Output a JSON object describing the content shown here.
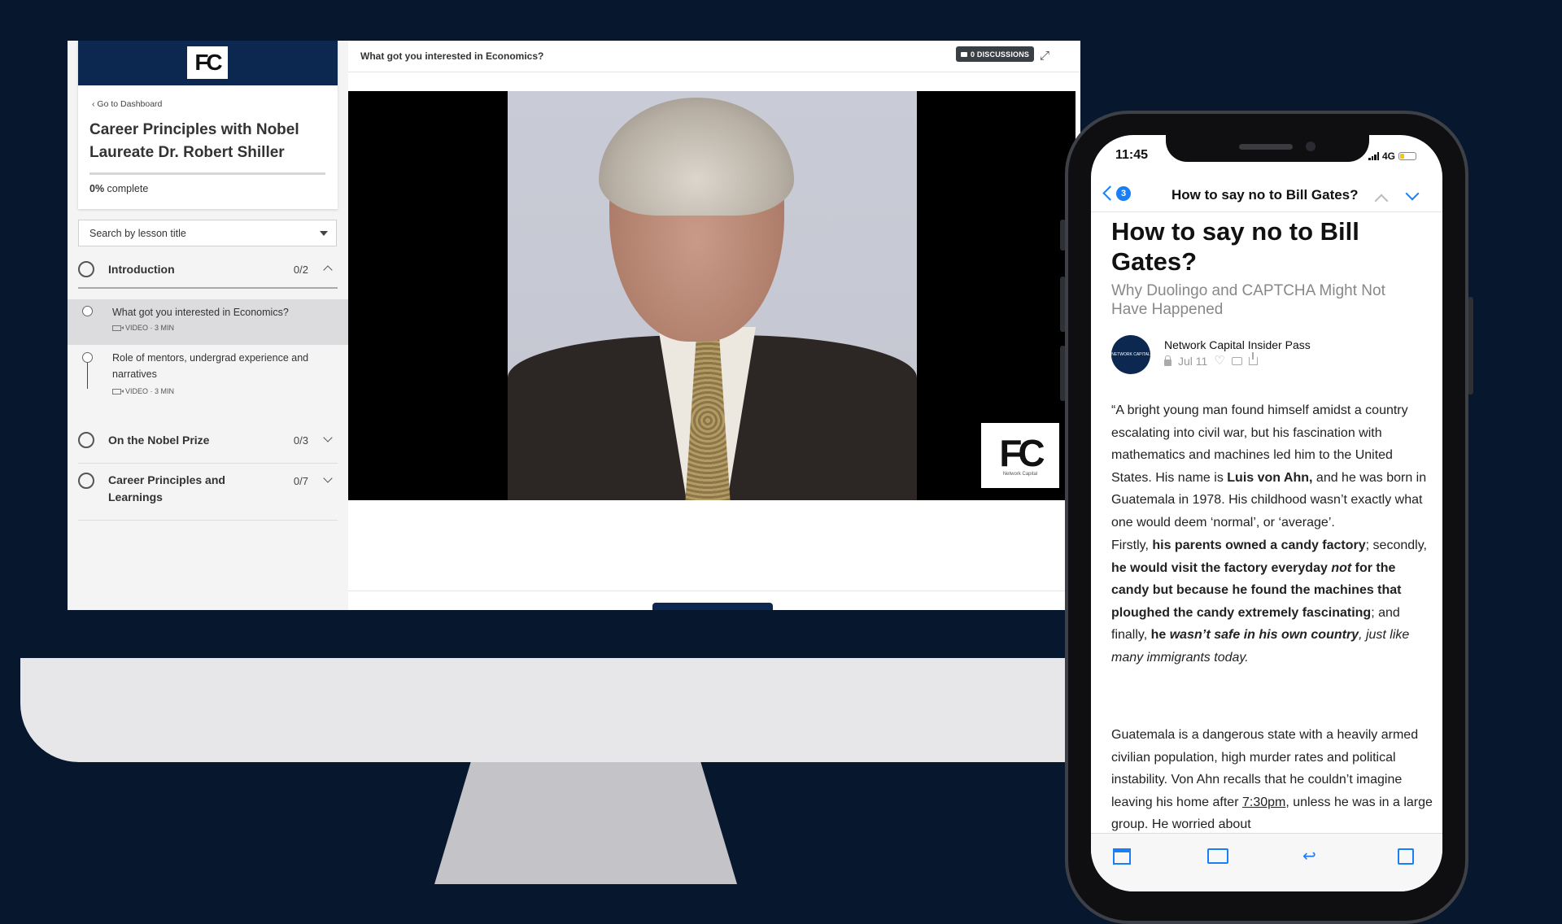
{
  "colors": {
    "background": "#06172e",
    "brand_navy": "#0d2850",
    "ios_blue": "#1a7ff5"
  },
  "course": {
    "logo_text": "FC",
    "go_to_dashboard": "Go to Dashboard",
    "title": "Career Principles with Nobel Laureate Dr. Robert Shiller",
    "progress_percent": 0,
    "progress_value": "0%",
    "progress_suffix": " complete",
    "search_placeholder": "Search by lesson title",
    "sections": [
      {
        "name": "Introduction",
        "count": "0/2",
        "expanded": true,
        "lessons": [
          {
            "title": "What got you interested in Economics?",
            "meta": "VIDEO · 3 MIN",
            "active": true
          },
          {
            "title": "Role of mentors, undergrad experience and narratives",
            "meta": "VIDEO · 3 MIN",
            "active": false
          }
        ]
      },
      {
        "name": "On the Nobel Prize",
        "count": "0/3",
        "expanded": false
      },
      {
        "name": "Career Principles and Learnings",
        "count": "0/7",
        "expanded": false
      }
    ]
  },
  "player": {
    "lesson_title": "What got you interested in Economics?",
    "discussions_label": "0 DISCUSSIONS",
    "watermark_logo": "FC",
    "watermark_caption": "Network Capital"
  },
  "phone": {
    "status_time": "11:45",
    "network": "4G",
    "nav": {
      "badge": "3",
      "title": "How to say no to Bill Gates?"
    },
    "article": {
      "title": "How to say no to Bill Gates?",
      "subtitle": "Why Duolingo and CAPTCHA Might Not Have Happened",
      "author": "Network Capital Insider Pass",
      "date": "Jul 11",
      "avatar_text": "NETWORK CAPITAL"
    }
  }
}
